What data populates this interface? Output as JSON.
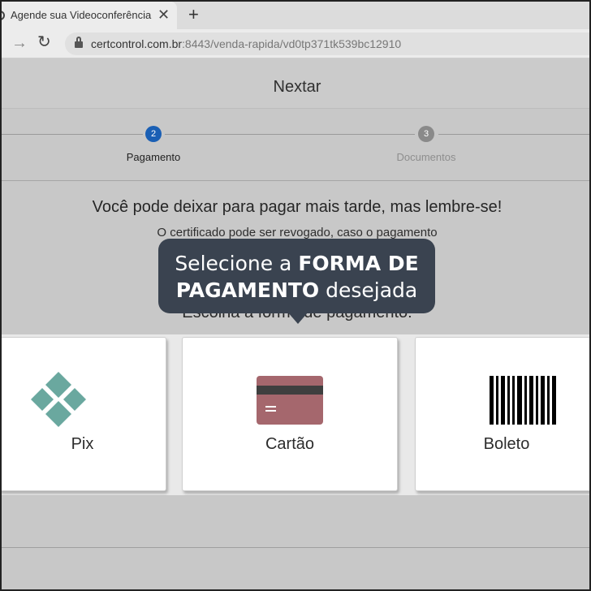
{
  "browser": {
    "tab_title": "Agende sua Videoconferência",
    "tab_close": "✕",
    "new_tab": "+",
    "url_host": "certcontrol.com.br",
    "url_path": ":8443/venda-rapida/vd0tp371tk539bc12910"
  },
  "page": {
    "header_title": "Nextar"
  },
  "stepper": {
    "steps": [
      {
        "number": "2",
        "label": "Pagamento",
        "state": "active",
        "color": "#1a5fb4"
      },
      {
        "number": "3",
        "label": "Documentos",
        "state": "inactive",
        "color": "#8a8a8a"
      }
    ]
  },
  "main": {
    "warning_title": "Você pode deixar para pagar mais tarde, mas lembre-se!",
    "warning_text": "O certificado pode ser revogado, caso o pagamento",
    "choose_label": "Escolha a forma de pagamento:"
  },
  "payment_options": [
    {
      "label": "Pix",
      "icon": "pix-icon",
      "color": "#6aa89f"
    },
    {
      "label": "Cartão",
      "icon": "credit-card-icon",
      "color": "#a5676d"
    },
    {
      "label": "Boleto",
      "icon": "barcode-icon",
      "color": "#000000"
    }
  ],
  "tooltip": {
    "line1_prefix": "Selecione a ",
    "line1_bold": "FORMA DE",
    "line2_bold": "PAGAMENTO",
    "line2_suffix": " desejada",
    "background": "#3a4350"
  }
}
